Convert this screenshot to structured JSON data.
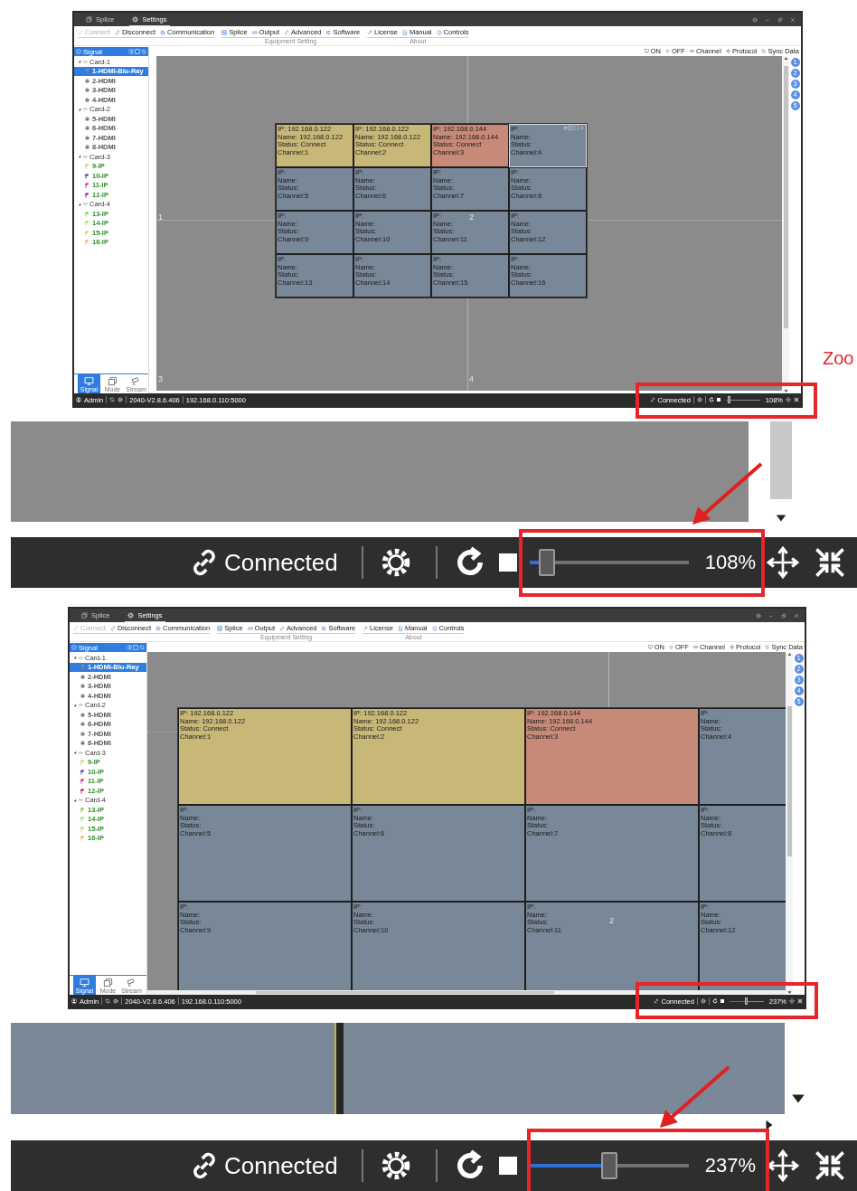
{
  "screens": [
    {
      "tabs": [
        {
          "label": "Splice",
          "kind": "copy",
          "selected": false
        },
        {
          "label": "Settings",
          "kind": "gear",
          "selected": true
        }
      ],
      "toolbar": [
        {
          "items": [
            {
              "label": "Connect",
              "kind": "link",
              "disabled": true
            },
            {
              "label": "Disconnect",
              "kind": "link",
              "disabled": false
            },
            {
              "label": "Communication",
              "kind": "gear",
              "disabled": false
            }
          ]
        },
        {
          "caption": "Equipment Setting",
          "items": [
            {
              "label": "Splice",
              "kind": "grid",
              "disabled": false
            },
            {
              "label": "Output",
              "kind": "output",
              "disabled": false
            },
            {
              "label": "Advanced",
              "kind": "link",
              "disabled": false
            },
            {
              "label": "Software",
              "kind": "sliders",
              "disabled": false
            }
          ]
        },
        {
          "caption": "About",
          "items": [
            {
              "label": "License",
              "kind": "wrench",
              "disabled": false
            },
            {
              "label": "Manual",
              "kind": "doc",
              "disabled": false
            },
            {
              "label": "Controls",
              "kind": "info",
              "disabled": false
            }
          ]
        }
      ],
      "right_toolbar": [
        {
          "label": "ON",
          "kind": "monitor"
        },
        {
          "label": "OFF",
          "kind": "power"
        },
        {
          "label": "Channel",
          "kind": "output"
        },
        {
          "label": "Protocol",
          "kind": "gear"
        },
        {
          "label": "Sync Data",
          "kind": "sync"
        }
      ],
      "sidebar": {
        "title": "Signal",
        "tree": [
          {
            "label": "Card-1",
            "expanded": true,
            "children": [
              {
                "label": "1-HDMI-Blu-Ray",
                "kind": "hdmi",
                "selected": true
              },
              {
                "label": "2-HDMI",
                "kind": "hdmi",
                "selected": false
              },
              {
                "label": "3-HDMI",
                "kind": "hdmi",
                "selected": false
              },
              {
                "label": "4-HDMI",
                "kind": "hdmi",
                "selected": false
              }
            ]
          },
          {
            "label": "Card-2",
            "expanded": true,
            "children": [
              {
                "label": "5-HDMI",
                "kind": "hdmi",
                "selected": false
              },
              {
                "label": "6-HDMI",
                "kind": "hdmi",
                "selected": false
              },
              {
                "label": "7-HDMI",
                "kind": "hdmi",
                "selected": false
              },
              {
                "label": "8-HDMI",
                "kind": "hdmi",
                "selected": false
              }
            ]
          },
          {
            "label": "Card-3",
            "expanded": true,
            "children": [
              {
                "label": "9-IP",
                "kind": "ip",
                "color": "#d8d080",
                "selected": false
              },
              {
                "label": "10-IP",
                "kind": "ip",
                "color": "#6050b0",
                "selected": false
              },
              {
                "label": "11-IP",
                "kind": "ip",
                "color": "#e04090",
                "selected": false
              },
              {
                "label": "12-IP",
                "kind": "ip",
                "color": "#c03080",
                "selected": false
              }
            ]
          },
          {
            "label": "Card-4",
            "expanded": true,
            "children": [
              {
                "label": "13-IP",
                "kind": "ip",
                "color": "#90d060",
                "selected": false
              },
              {
                "label": "14-IP",
                "kind": "ip",
                "color": "#a8e878",
                "selected": false
              },
              {
                "label": "15-IP",
                "kind": "ip",
                "color": "#d8d080",
                "selected": false
              },
              {
                "label": "16-IP",
                "kind": "ip",
                "color": "#e8c070",
                "selected": false
              }
            ]
          }
        ],
        "bottom_tabs": [
          {
            "label": "Signal",
            "kind": "monitor",
            "selected": true
          },
          {
            "label": "Mode",
            "kind": "copy",
            "selected": false
          },
          {
            "label": "Stream",
            "kind": "camera",
            "selected": false
          }
        ]
      },
      "canvas": {
        "screen_numbers": [
          "1",
          "2",
          "3",
          "4"
        ],
        "layer_buttons": [
          "1",
          "2",
          "3",
          "4",
          "5"
        ],
        "windows": [
          {
            "lines": [
              "IP: 192.168.0.122",
              "Name: 192.168.0.122",
              "Status: Connect",
              "Channel:1"
            ],
            "color": "#c8b878",
            "active": false
          },
          {
            "lines": [
              "IP: 192.168.0.122",
              "Name: 192.168.0.122",
              "Status: Connect",
              "Channel:2"
            ],
            "color": "#c8b878",
            "active": false
          },
          {
            "lines": [
              "IP: 192.168.0.144",
              "Name: 192.168.0.144",
              "Status: Connect",
              "Channel:3"
            ],
            "color": "#c88a78",
            "active": false
          },
          {
            "lines": [
              "IP:",
              "Name:",
              "Status:",
              "Channel:4"
            ],
            "color": "#788898",
            "active": true
          },
          {
            "lines": [
              "IP:",
              "Name:",
              "Status:",
              "Channel:5"
            ],
            "color": "#788898",
            "active": false
          },
          {
            "lines": [
              "IP:",
              "Name:",
              "Status:",
              "Channel:6"
            ],
            "color": "#788898",
            "active": false
          },
          {
            "lines": [
              "IP:",
              "Name:",
              "Status:",
              "Channel:7"
            ],
            "color": "#788898",
            "active": false
          },
          {
            "lines": [
              "IP:",
              "Name:",
              "Status:",
              "Channel:8"
            ],
            "color": "#788898",
            "active": false
          },
          {
            "lines": [
              "IP:",
              "Name:",
              "Status:",
              "Channel:9"
            ],
            "color": "#788898",
            "active": false
          },
          {
            "lines": [
              "IP:",
              "Name:",
              "Status:",
              "Channel:10"
            ],
            "color": "#788898",
            "active": false
          },
          {
            "lines": [
              "IP:",
              "Name:",
              "Status:",
              "Channel:11"
            ],
            "color": "#788898",
            "active": false
          },
          {
            "lines": [
              "IP:",
              "Name:",
              "Status:",
              "Channel:12"
            ],
            "color": "#788898",
            "active": false
          },
          {
            "lines": [
              "IP:",
              "Name:",
              "Status:",
              "Channel:13"
            ],
            "color": "#788898",
            "active": false
          },
          {
            "lines": [
              "IP:",
              "Name:",
              "Status:",
              "Channel:14"
            ],
            "color": "#788898",
            "active": false
          },
          {
            "lines": [
              "IP:",
              "Name:",
              "Status:",
              "Channel:15"
            ],
            "color": "#788898",
            "active": false
          },
          {
            "lines": [
              "IP:",
              "Name:",
              "Status:",
              "Channel:16"
            ],
            "color": "#788898",
            "active": false
          }
        ]
      },
      "status_bar": {
        "user": "Admin",
        "version": "2040-V2.8.6.406",
        "address": "192.168.0.110:5000",
        "connection": "Connected",
        "zoom": {
          "level": 0.06,
          "reading": "108%"
        }
      }
    },
    {
      "tabs": [
        {
          "label": "Splice",
          "kind": "copy",
          "selected": false
        },
        {
          "label": "Settings",
          "kind": "gear",
          "selected": true
        }
      ],
      "toolbar": [
        {
          "items": [
            {
              "label": "Connect",
              "kind": "link",
              "disabled": true
            },
            {
              "label": "Disconnect",
              "kind": "link",
              "disabled": false
            },
            {
              "label": "Communication",
              "kind": "gear",
              "disabled": false
            }
          ]
        },
        {
          "caption": "Equipment Setting",
          "items": [
            {
              "label": "Splice",
              "kind": "grid",
              "disabled": false
            },
            {
              "label": "Output",
              "kind": "output",
              "disabled": false
            },
            {
              "label": "Advanced",
              "kind": "link",
              "disabled": false
            },
            {
              "label": "Software",
              "kind": "sliders",
              "disabled": false
            }
          ]
        },
        {
          "caption": "About",
          "items": [
            {
              "label": "License",
              "kind": "wrench",
              "disabled": false
            },
            {
              "label": "Manual",
              "kind": "doc",
              "disabled": false
            },
            {
              "label": "Controls",
              "kind": "info",
              "disabled": false
            }
          ]
        }
      ],
      "right_toolbar": [
        {
          "label": "ON",
          "kind": "monitor"
        },
        {
          "label": "OFF",
          "kind": "power"
        },
        {
          "label": "Channel",
          "kind": "output"
        },
        {
          "label": "Protocol",
          "kind": "gear"
        },
        {
          "label": "Sync Data",
          "kind": "sync"
        }
      ],
      "sidebar": {
        "title": "Signal",
        "tree": [
          {
            "label": "Card-1",
            "expanded": true,
            "children": [
              {
                "label": "1-HDMI-Blu-Ray",
                "kind": "hdmi",
                "selected": true
              },
              {
                "label": "2-HDMI",
                "kind": "hdmi",
                "selected": false
              },
              {
                "label": "3-HDMI",
                "kind": "hdmi",
                "selected": false
              },
              {
                "label": "4-HDMI",
                "kind": "hdmi",
                "selected": false
              }
            ]
          },
          {
            "label": "Card-2",
            "expanded": true,
            "children": [
              {
                "label": "5-HDMI",
                "kind": "hdmi",
                "selected": false
              },
              {
                "label": "6-HDMI",
                "kind": "hdmi",
                "selected": false
              },
              {
                "label": "7-HDMI",
                "kind": "hdmi",
                "selected": false
              },
              {
                "label": "8-HDMI",
                "kind": "hdmi",
                "selected": false
              }
            ]
          },
          {
            "label": "Card-3",
            "expanded": true,
            "children": [
              {
                "label": "9-IP",
                "kind": "ip",
                "color": "#d8d080",
                "selected": false
              },
              {
                "label": "10-IP",
                "kind": "ip",
                "color": "#6050b0",
                "selected": false
              },
              {
                "label": "11-IP",
                "kind": "ip",
                "color": "#e04090",
                "selected": false
              },
              {
                "label": "12-IP",
                "kind": "ip",
                "color": "#c03080",
                "selected": false
              }
            ]
          },
          {
            "label": "Card-4",
            "expanded": true,
            "children": [
              {
                "label": "13-IP",
                "kind": "ip",
                "color": "#90d060",
                "selected": false
              },
              {
                "label": "14-IP",
                "kind": "ip",
                "color": "#a8e878",
                "selected": false
              },
              {
                "label": "15-IP",
                "kind": "ip",
                "color": "#d8d080",
                "selected": false
              },
              {
                "label": "16-IP",
                "kind": "ip",
                "color": "#e8c070",
                "selected": false
              }
            ]
          }
        ],
        "bottom_tabs": [
          {
            "label": "Signal",
            "kind": "monitor",
            "selected": true
          },
          {
            "label": "Mode",
            "kind": "copy",
            "selected": false
          },
          {
            "label": "Stream",
            "kind": "camera",
            "selected": false
          }
        ]
      },
      "canvas": {
        "screen_numbers": [
          "2"
        ],
        "layer_buttons": [
          "1",
          "2",
          "3",
          "4",
          "5"
        ],
        "windows": [
          {
            "lines": [
              "IP: 192.168.0.122",
              "Name: 192.168.0.122",
              "Status: Connect",
              "Channel:1"
            ],
            "color": "#c8b878",
            "active": false
          },
          {
            "lines": [
              "IP: 192.168.0.122",
              "Name: 192.168.0.122",
              "Status: Connect",
              "Channel:2"
            ],
            "color": "#c8b878",
            "active": false
          },
          {
            "lines": [
              "IP: 192.168.0.144",
              "Name: 192.168.0.144",
              "Status: Connect",
              "Channel:3"
            ],
            "color": "#c88a78",
            "active": false
          },
          {
            "lines": [
              "IP:",
              "Name:",
              "Status:",
              "Channel:4"
            ],
            "color": "#788898",
            "active": false
          },
          {
            "lines": [
              "IP:",
              "Name:",
              "Status:",
              "Channel:5"
            ],
            "color": "#788898",
            "active": false
          },
          {
            "lines": [
              "IP:",
              "Name:",
              "Status:",
              "Channel:6"
            ],
            "color": "#788898",
            "active": false
          },
          {
            "lines": [
              "IP:",
              "Name:",
              "Status:",
              "Channel:7"
            ],
            "color": "#788898",
            "active": false
          },
          {
            "lines": [
              "IP:",
              "Name:",
              "Status:",
              "Channel:8"
            ],
            "color": "#788898",
            "active": false
          },
          {
            "lines": [
              "IP:",
              "Name:",
              "Status:",
              "Channel:9"
            ],
            "color": "#788898",
            "active": false
          },
          {
            "lines": [
              "IP:",
              "Name:",
              "Status:",
              "Channel:10"
            ],
            "color": "#788898",
            "active": false
          },
          {
            "lines": [
              "IP:",
              "Name:",
              "Status:",
              "Channel:11"
            ],
            "color": "#788898",
            "active": false
          },
          {
            "lines": [
              "IP:",
              "Name:",
              "Status:",
              "Channel:12"
            ],
            "color": "#788898",
            "active": false
          }
        ]
      },
      "status_bar": {
        "user": "Admin",
        "version": "2040-V2.8.6.406",
        "address": "192.168.0.110:5000",
        "connection": "Connected",
        "zoom": {
          "level": 0.45,
          "reading": "237%"
        }
      }
    }
  ],
  "insets": [
    {
      "connection": "Connected",
      "zoom": {
        "level": 0.06,
        "reading": "108%"
      }
    },
    {
      "connection": "Connected",
      "zoom": {
        "level": 0.45,
        "reading": "237%"
      }
    }
  ],
  "side_label": "Zoo"
}
